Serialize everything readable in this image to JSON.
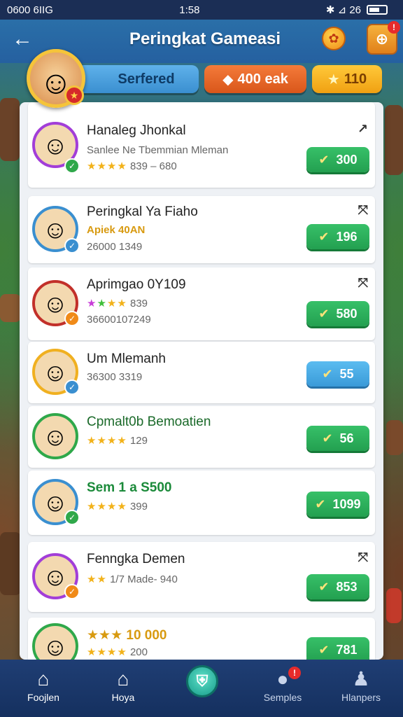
{
  "status_bar": {
    "left": "0600 6IIG",
    "time": "1:58",
    "right": "✱ ⊿ 26"
  },
  "header": {
    "title": "Peringkat Gameasi",
    "back_icon": "arrow-left-icon",
    "trophy_icon": "trophy-icon",
    "gift_icon": "gift-icon",
    "gift_badge": "!"
  },
  "player": {
    "name": "Serfered",
    "coins": "400 eak",
    "stars": "110",
    "badge_icon": "star-icon"
  },
  "colors": {
    "green_button": "#23a050",
    "blue_button": "#3a9ad8",
    "header_blue": "#2560a0",
    "nav_bg": "#15305f"
  },
  "leaderboard": [
    {
      "title": "Hanaleg Jhonkal",
      "subtitle": "Sanlee Ne Tbemmian Mleman",
      "stars": "★★★★",
      "meta": "839 – 680",
      "score": "300",
      "avatar_ring": "#a23ed8",
      "badge_color": "#2fa84a",
      "menu": "↗"
    },
    {
      "title": "Peringkal Ya Fiaho",
      "subtitle": "Apiek 40AN",
      "meta": "26000 1349",
      "score": "196",
      "avatar_ring": "#3a8fd0",
      "badge_color": "#3a8fd0",
      "menu": "⤧"
    },
    {
      "title": "Aprimgao 0Y109",
      "stars": "★★★★",
      "meta": "839",
      "meta2": "36600107249",
      "score": "580",
      "avatar_ring": "#c2302a",
      "badge_color": "#f08a18",
      "menu": "⤧"
    },
    {
      "title": "Um Mlemanh",
      "meta": "36300 3319",
      "score": "55",
      "avatar_ring": "#f0b020",
      "badge_color": "#3a8fd0",
      "blue": true
    },
    {
      "title": "Cpmalt0b Bemoatien",
      "stars": "★★★★",
      "meta": "129",
      "score": "56",
      "avatar_ring": "#2fa84a",
      "badge_color": "#2fa84a"
    },
    {
      "title": "Sem 1 a S500",
      "stars": "★★★★",
      "meta": "399",
      "score": "1099",
      "avatar_ring": "#3a8fd0",
      "badge_color": "#2fa84a"
    },
    {
      "title": "Fenngka Demen",
      "stars": "★★",
      "meta": "1/7 Made- 940",
      "score": "853",
      "avatar_ring": "#a23ed8",
      "badge_color": "#f08a18",
      "menu": "⤧"
    },
    {
      "title": "★★★ 10 000",
      "stars": "★★★★",
      "meta": "200",
      "score": "781",
      "avatar_ring": "#2fa84a",
      "badge_color": "#e62b2b"
    }
  ],
  "nav": [
    {
      "label": "Foojlen",
      "icon": "home-icon"
    },
    {
      "label": "Hoya",
      "icon": "home-icon"
    },
    {
      "label": "",
      "icon": "shield-icon"
    },
    {
      "label": "Semples",
      "icon": "globe-icon",
      "badge": "!"
    },
    {
      "label": "Hlanpers",
      "icon": "user-icon"
    }
  ]
}
